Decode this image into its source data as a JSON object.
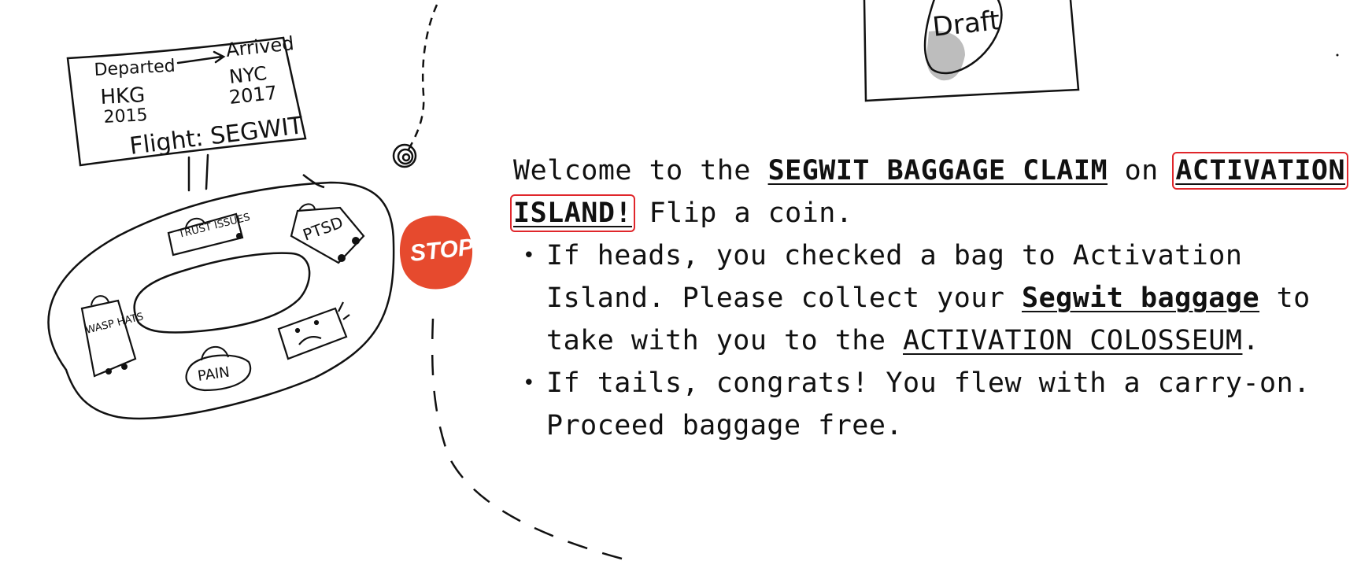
{
  "scene": {
    "sign": {
      "departed": "Departed",
      "arrived": "Arrived",
      "from_city": "HKG",
      "from_year": "2015",
      "to_city": "NYC",
      "to_year": "2017",
      "flight": "Flight: SEGWIT"
    },
    "bags": [
      "TRUST ISSUES",
      "PTSD",
      "WASP HATS",
      "PAIN"
    ],
    "stop_sign": "STOP",
    "draft_label": "Draft"
  },
  "story": {
    "intro_1": "Welcome to the ",
    "link_claim": "SEGWIT BAGGAGE CLAIM",
    "intro_2": " on ",
    "link_island_1": "ACTIVATION",
    "link_island_2": "ISLAND!",
    "intro_3": " Flip a coin.",
    "bullet_1_a": "If heads, you checked a bag to Activation Island. Please collect your ",
    "link_baggage": "Segwit baggage",
    "bullet_1_b": " to take with you to the ",
    "link_colosseum": "ACTIVATION COLOSSEUM",
    "bullet_1_c": ".",
    "bullet_2": "If tails, congrats! You flew with a carry-on. Proceed baggage free."
  },
  "colors": {
    "stop_red": "#e64a2e",
    "highlight_box": "#e0262b",
    "draft_shadow": "#bdbdbd"
  }
}
